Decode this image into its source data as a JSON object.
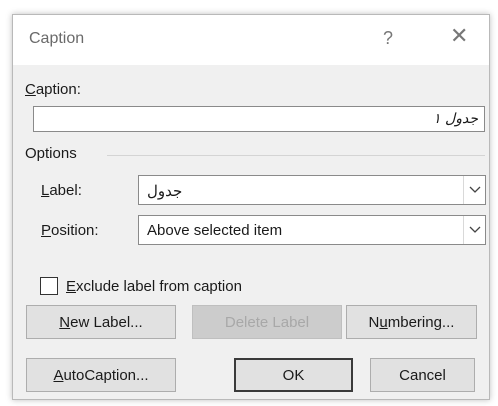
{
  "window": {
    "title": "Caption",
    "help_glyph": "?",
    "close_glyph": "✕"
  },
  "caption": {
    "label_prefix": "C",
    "label_rest": "aption:",
    "value": "جدول ١"
  },
  "options": {
    "group_label": "Options",
    "label_field": {
      "label_prefix": "L",
      "label_rest": "abel:",
      "value": "جدول"
    },
    "position_field": {
      "label_prefix": "P",
      "label_rest": "osition:",
      "value": "Above selected item"
    }
  },
  "exclude": {
    "label_prefix": "E",
    "label_rest": "xclude label from caption",
    "checked": false
  },
  "buttons": {
    "new_label_prefix": "N",
    "new_label_rest": "ew Label...",
    "delete_label": "Delete Label",
    "numbering_pre": "N",
    "numbering_u": "u",
    "numbering_rest": "mbering...",
    "autocaption_prefix": "A",
    "autocaption_rest": "utoCaption...",
    "ok": "OK",
    "cancel": "Cancel"
  },
  "icons": {
    "help": "help-icon",
    "close": "close-icon",
    "dropdown": "chevron-down-icon"
  }
}
